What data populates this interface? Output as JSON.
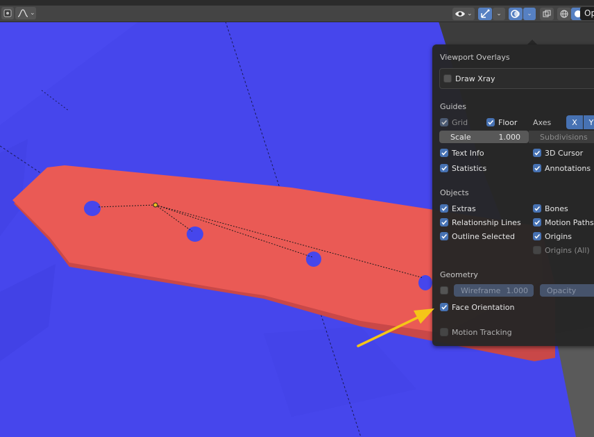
{
  "header": {
    "right_label": "Op"
  },
  "overlays": {
    "title": "Viewport Overlays",
    "draw_xray": {
      "label": "Draw Xray",
      "checked": false
    },
    "guides": {
      "title": "Guides",
      "grid": {
        "label": "Grid",
        "checked": true
      },
      "floor": {
        "label": "Floor",
        "checked": true
      },
      "axes_label": "Axes",
      "axis_x": "X",
      "axis_y": "Y",
      "scale_label": "Scale",
      "scale_value": "1.000",
      "subdivisions_label": "Subdivisions",
      "text_info": {
        "label": "Text Info",
        "checked": true
      },
      "cursor_3d": {
        "label": "3D Cursor",
        "checked": true
      },
      "statistics": {
        "label": "Statistics",
        "checked": true
      },
      "annotations": {
        "label": "Annotations",
        "checked": true
      }
    },
    "objects": {
      "title": "Objects",
      "extras": {
        "label": "Extras",
        "checked": true
      },
      "bones": {
        "label": "Bones",
        "checked": true
      },
      "relationship_lines": {
        "label": "Relationship Lines",
        "checked": true
      },
      "motion_paths": {
        "label": "Motion Paths",
        "checked": true
      },
      "outline_selected": {
        "label": "Outline Selected",
        "checked": true
      },
      "origins": {
        "label": "Origins",
        "checked": true
      },
      "origins_all": {
        "label": "Origins (All)",
        "checked": false
      }
    },
    "geometry": {
      "title": "Geometry",
      "wireframe_label": "Wireframe",
      "wireframe_value": "1.000",
      "opacity_label": "Opacity",
      "face_orientation": {
        "label": "Face Orientation",
        "checked": true
      }
    },
    "motion_tracking": {
      "label": "Motion Tracking",
      "checked": false
    }
  },
  "colors": {
    "surface_blue": "#4b4bf0",
    "face_red": "#e85555",
    "accent": "#4772b3",
    "arrow": "#f5c518"
  }
}
